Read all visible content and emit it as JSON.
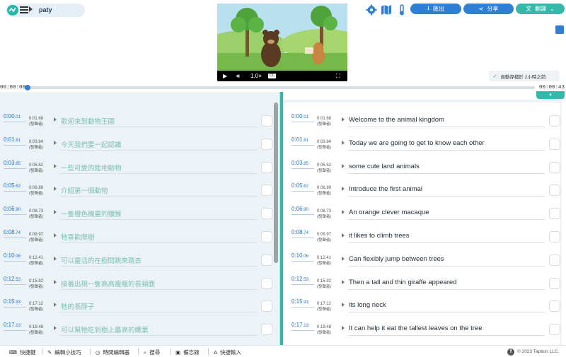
{
  "header": {
    "project_name": "paty",
    "buttons": {
      "export": "匯出",
      "share": "分享",
      "translate": "翻譯"
    },
    "autosave": "自動存檔於 2小時之前"
  },
  "video": {
    "speed": "1.0×",
    "cc": "CC"
  },
  "timeline": {
    "current": "00:00:00",
    "total": "00:00:43",
    "progress": 0.0
  },
  "segments": [
    {
      "start": "0:00",
      "start_ms": ".01",
      "end": "0:01.68",
      "speaker": "(發聲者)",
      "zh": "歡迎來到動物王國",
      "en": "Welcome to the animal kingdom"
    },
    {
      "start": "0:01",
      "start_ms": ".81",
      "end": "0:03.84",
      "speaker": "(發聲者)",
      "zh": "今天我們要一起認識",
      "en": "Today we are going to get to know each other"
    },
    {
      "start": "0:03",
      "start_ms": ".85",
      "end": "0:05.52",
      "speaker": "(發聲者)",
      "zh": "一些可愛的陸地動物",
      "en": "some cute land animals"
    },
    {
      "start": "0:05",
      "start_ms": ".62",
      "end": "0:06.89",
      "speaker": "(發聲者)",
      "zh": "介紹第一個動物",
      "en": "Introduce the first animal"
    },
    {
      "start": "0:06",
      "start_ms": ".90",
      "end": "0:08.73",
      "speaker": "(發聲者)",
      "zh": "一隻橙色機靈的獼猴",
      "en": "An orange clever macaque"
    },
    {
      "start": "0:08",
      "start_ms": ".74",
      "end": "0:09.97",
      "speaker": "(發聲者)",
      "zh": "牠喜歡爬樹",
      "en": "it likes to climb trees"
    },
    {
      "start": "0:10",
      "start_ms": ".06",
      "end": "0:12.41",
      "speaker": "(發聲者)",
      "zh": "可以靈活的在樹間跳來跳去",
      "en": "Can flexibly jump between trees"
    },
    {
      "start": "0:12",
      "start_ms": ".53",
      "end": "0:15.92",
      "speaker": "(發聲者)",
      "zh": "接著出現一隻高高瘦瘦的長頸鹿",
      "en": "Then a tall and thin giraffe appeared"
    },
    {
      "start": "0:15",
      "start_ms": ".93",
      "end": "0:17.12",
      "speaker": "(發聲者)",
      "zh": "牠的長脖子",
      "en": "its long neck"
    },
    {
      "start": "0:17",
      "start_ms": ".13",
      "end": "0:19.48",
      "speaker": "(發聲者)",
      "zh": "可以幫牠吃到樹上最高的嫩葉",
      "en": "It can help it eat the tallest leaves on the tree"
    }
  ],
  "bottom_bar": {
    "shortcuts": "快捷鍵",
    "tips": "編輯小技巧",
    "time_editor": "時間編輯器",
    "search": "搜尋",
    "memo": "備忘錄",
    "quick_input": "快捷輸入",
    "copyright": "© 2023 Taption LLC."
  },
  "colors": {
    "accent_blue": "#2f7fd6",
    "accent_teal": "#34b8a9"
  }
}
